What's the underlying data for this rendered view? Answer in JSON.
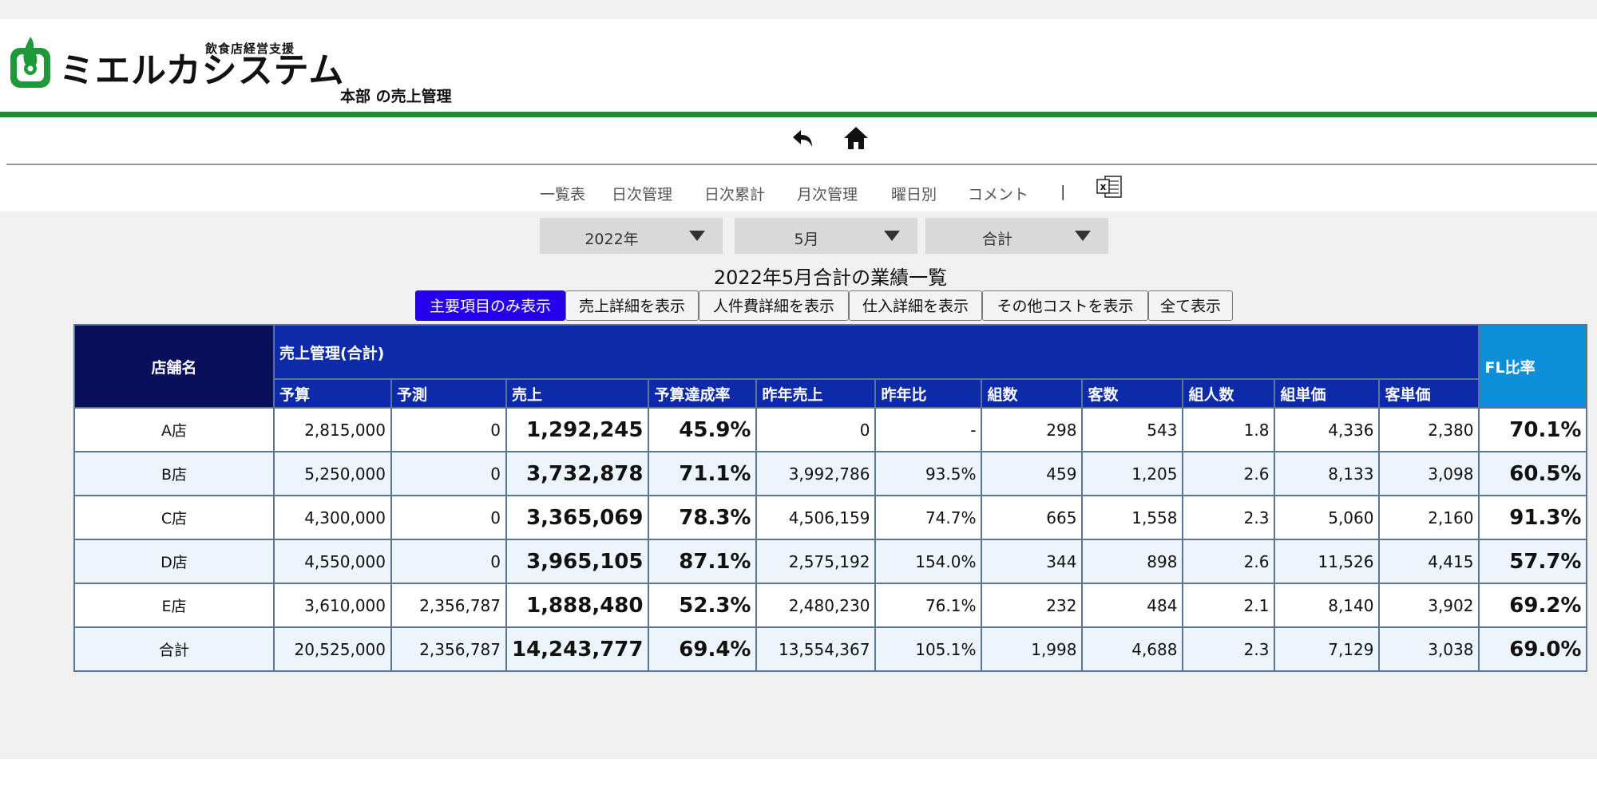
{
  "logo": {
    "sub": "飲食店経営支援",
    "main": "ミエルカシステム"
  },
  "page_subtitle": "本部 の売上管理",
  "nav": {
    "items": [
      "一覧表",
      "日次管理",
      "日次累計",
      "月次管理",
      "曜日別",
      "コメント"
    ],
    "separator": "|",
    "excel_label": "x"
  },
  "filters": {
    "year": "2022年",
    "month": "5月",
    "scope": "合計"
  },
  "table_title": "2022年5月合計の業績一覧",
  "view_buttons": [
    "主要項目のみ表示",
    "売上詳細を表示",
    "人件費詳細を表示",
    "仕入詳細を表示",
    "その他コストを表示",
    "全て表示"
  ],
  "active_view": "主要項目のみ表示",
  "table": {
    "store_header": "店舗名",
    "group_header": "売上管理(合計)",
    "fl_header": "FL比率",
    "columns": [
      "予算",
      "予測",
      "売上",
      "予算達成率",
      "昨年売上",
      "昨年比",
      "組数",
      "客数",
      "組人数",
      "組単価",
      "客単価"
    ],
    "rows": [
      [
        "A店",
        "2,815,000",
        "0",
        "1,292,245",
        "45.9%",
        "0",
        "-",
        "298",
        "543",
        "1.8",
        "4,336",
        "2,380",
        "70.1%"
      ],
      [
        "B店",
        "5,250,000",
        "0",
        "3,732,878",
        "71.1%",
        "3,992,786",
        "93.5%",
        "459",
        "1,205",
        "2.6",
        "8,133",
        "3,098",
        "60.5%"
      ],
      [
        "C店",
        "4,300,000",
        "0",
        "3,365,069",
        "78.3%",
        "4,506,159",
        "74.7%",
        "665",
        "1,558",
        "2.3",
        "5,060",
        "2,160",
        "91.3%"
      ],
      [
        "D店",
        "4,550,000",
        "0",
        "3,965,105",
        "87.1%",
        "2,575,192",
        "154.0%",
        "344",
        "898",
        "2.6",
        "11,526",
        "4,415",
        "57.7%"
      ],
      [
        "E店",
        "3,610,000",
        "2,356,787",
        "1,888,480",
        "52.3%",
        "2,480,230",
        "76.1%",
        "232",
        "484",
        "2.1",
        "8,140",
        "3,902",
        "69.2%"
      ],
      [
        "合計",
        "20,525,000",
        "2,356,787",
        "14,243,777",
        "69.4%",
        "13,554,367",
        "105.1%",
        "1,998",
        "4,688",
        "2.3",
        "7,129",
        "3,038",
        "69.0%"
      ]
    ]
  },
  "colors": {
    "brand_green": "#1f8a3a",
    "header_navy": "#0a0f5c",
    "header_blue": "#0d2ba8",
    "fl_blue": "#0b8fd8",
    "active_button": "#2600ee"
  },
  "icons": [
    "logo-flame-icon",
    "back-icon",
    "home-icon",
    "excel-icon",
    "chevron-down-icon"
  ]
}
